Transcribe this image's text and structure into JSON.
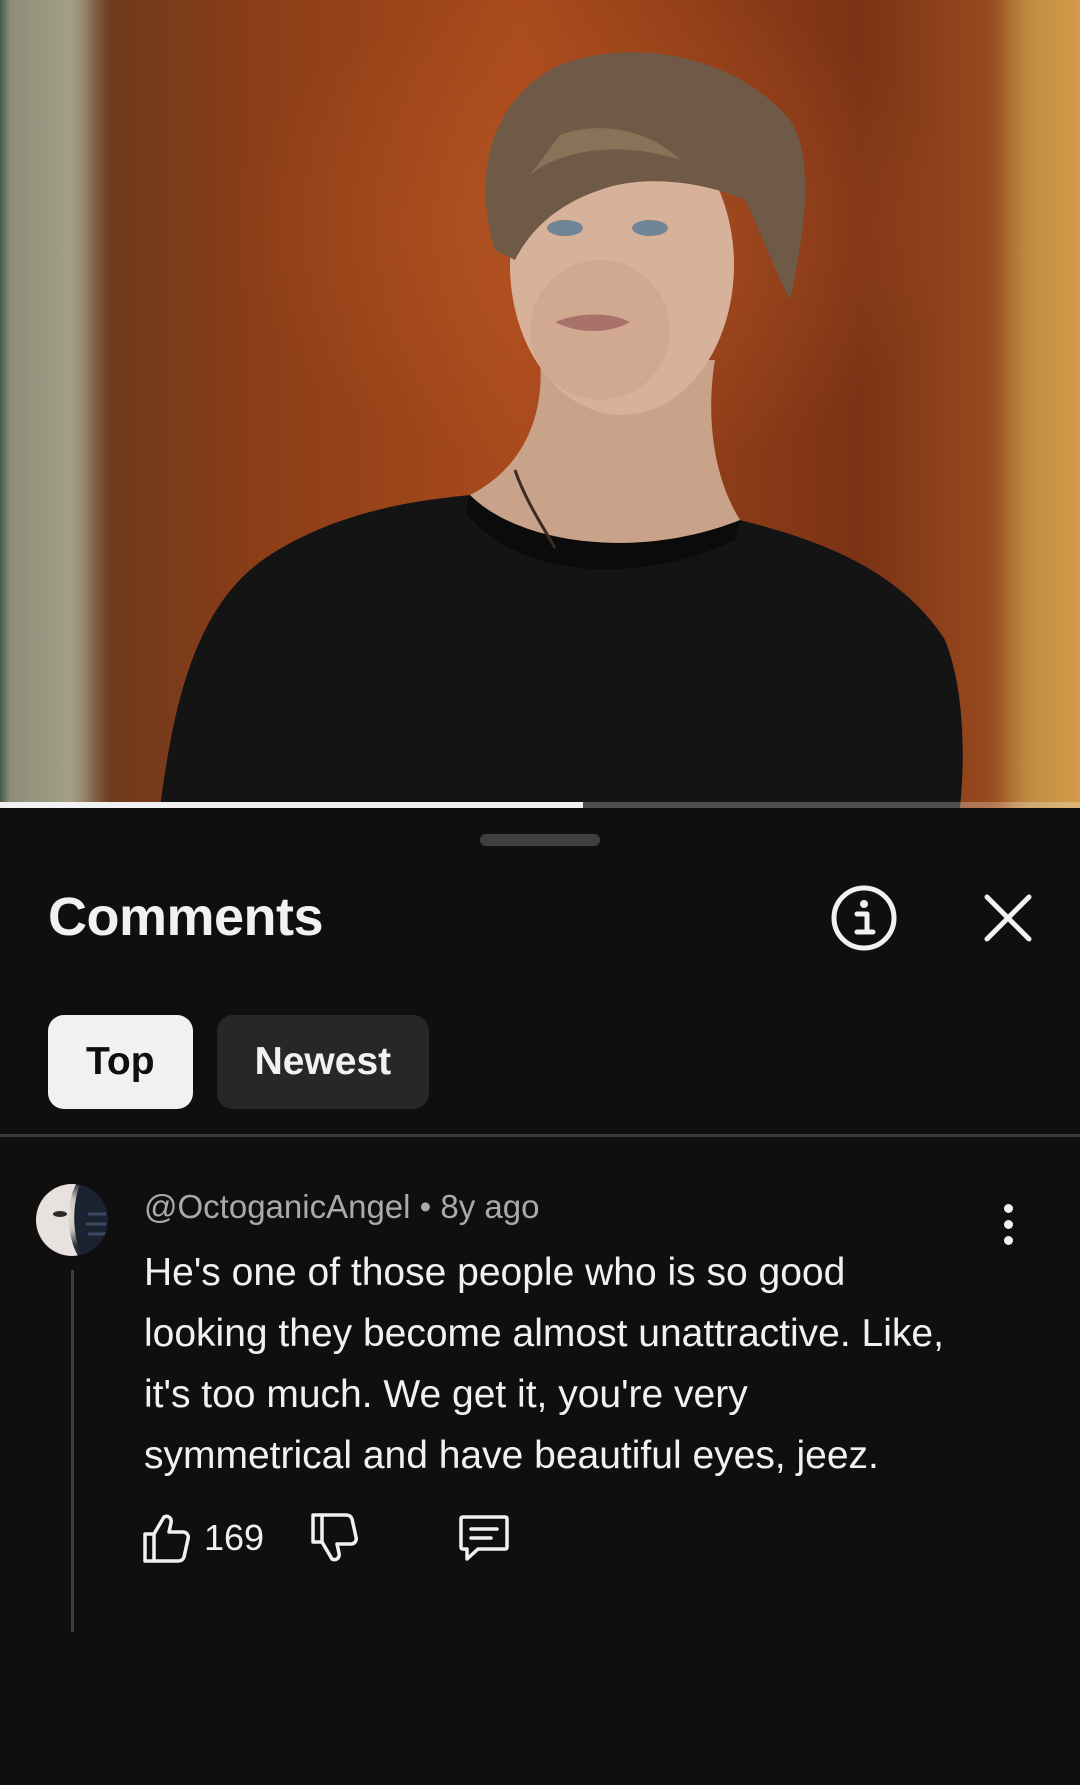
{
  "video": {
    "progress_percent": 54
  },
  "comments_panel": {
    "title": "Comments",
    "info_icon": "info-icon",
    "close_icon": "close-icon",
    "sort_chips": [
      {
        "label": "Top",
        "selected": true
      },
      {
        "label": "Newest",
        "selected": false
      }
    ]
  },
  "comment": {
    "author": "@OctoganicAngel",
    "separator": "•",
    "age": "8y ago",
    "text": "He's one of those people who is so good looking they become almost unattractive. Like, it's too much. We get it, you're very symmetrical and have beautiful eyes, jeez.",
    "like_count": "169",
    "icons": [
      "thumbs-up-icon",
      "thumbs-down-icon",
      "reply-icon",
      "more-vert-icon"
    ]
  },
  "colors": {
    "background": "#0f0f0f",
    "text_primary": "#f1f1f1",
    "text_secondary": "#aaaaaa",
    "chip_inactive": "#272727"
  }
}
